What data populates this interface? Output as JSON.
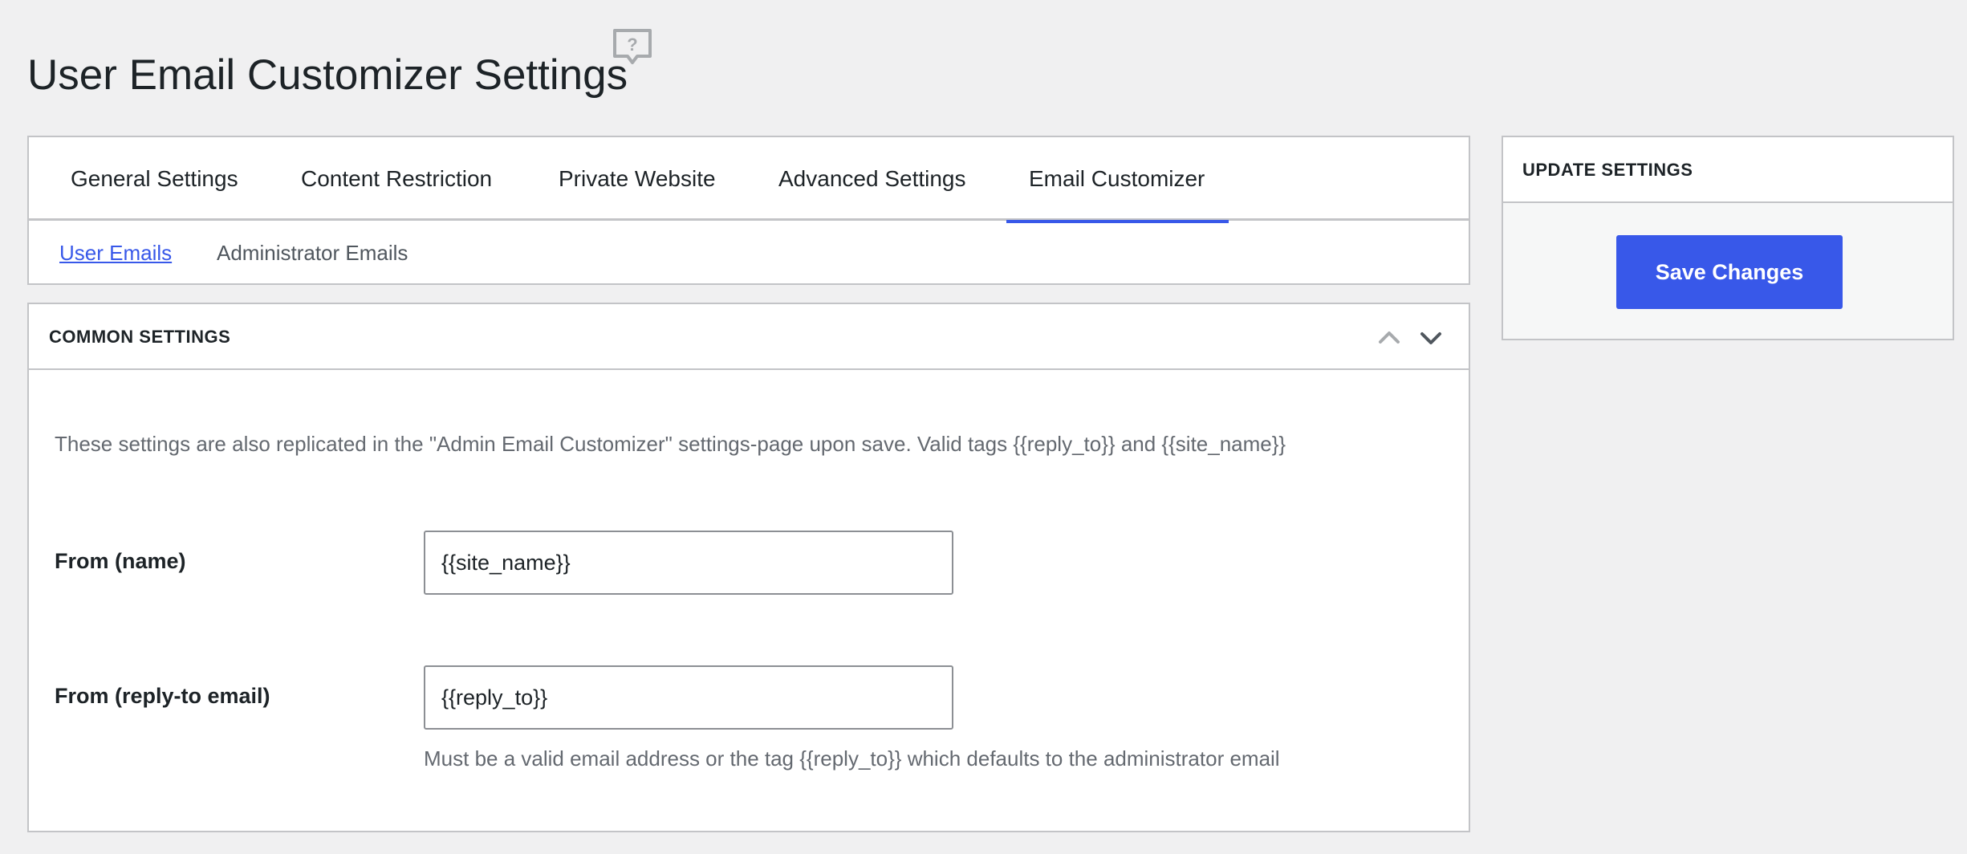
{
  "page": {
    "title": "User Email Customizer Settings",
    "help_icon": "help-bubble-icon"
  },
  "tabs": {
    "main": [
      {
        "label": "General Settings",
        "active": false
      },
      {
        "label": "Content Restriction",
        "active": false
      },
      {
        "label": "Private Website",
        "active": false
      },
      {
        "label": "Advanced Settings",
        "active": false
      },
      {
        "label": "Email Customizer",
        "active": true
      }
    ],
    "sub": [
      {
        "label": "User Emails",
        "active": true
      },
      {
        "label": "Administrator Emails",
        "active": false
      }
    ]
  },
  "common_settings": {
    "title": "COMMON SETTINGS",
    "collapse_up_icon": "chevron-up-icon",
    "collapse_down_icon": "chevron-down-icon",
    "intro": "These settings are also replicated in the \"Admin Email Customizer\" settings-page upon save. Valid tags {{reply_to}} and {{site_name}}",
    "fields": [
      {
        "label": "From (name)",
        "value": "{{site_name}}"
      },
      {
        "label": "From (reply-to email)",
        "value": "{{reply_to}}",
        "description": "Must be a valid email address or the tag {{reply_to}} which defaults to the administrator email"
      }
    ]
  },
  "update_settings": {
    "title": "UPDATE SETTINGS",
    "save_label": "Save Changes"
  },
  "colors": {
    "accent": "#3858e9",
    "background": "#f0f0f1",
    "border": "#c3c4c7",
    "muted_text": "#646970"
  }
}
